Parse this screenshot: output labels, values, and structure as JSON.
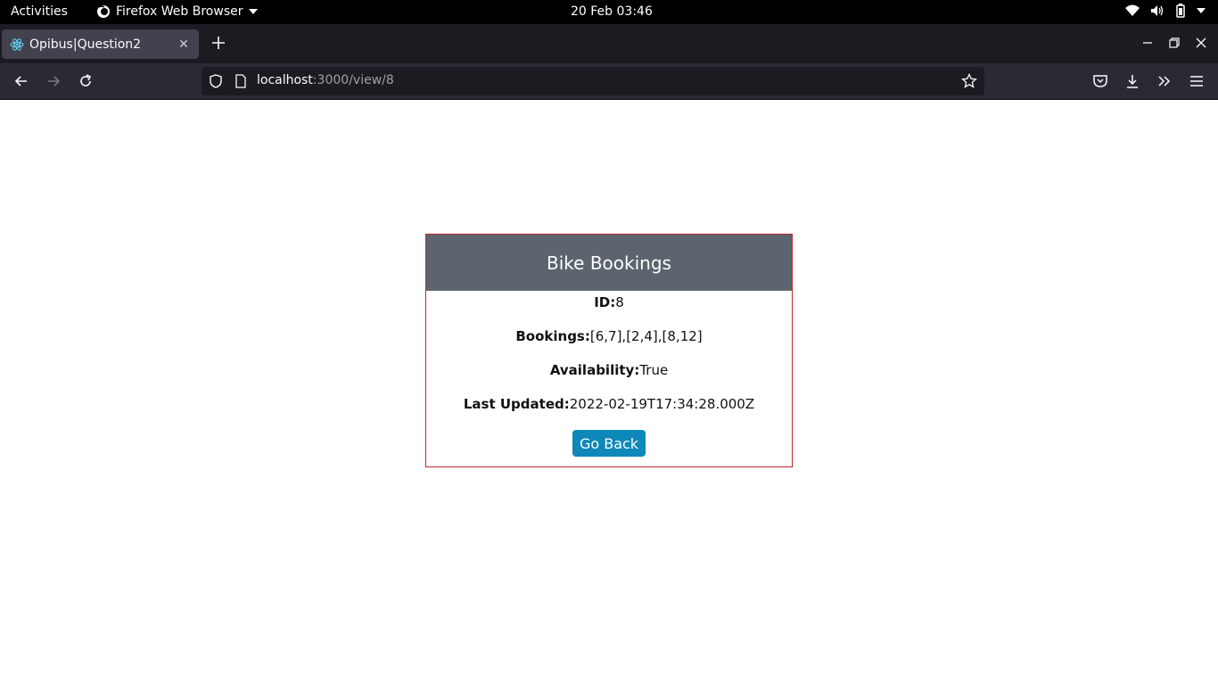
{
  "system_bar": {
    "activities": "Activities",
    "app_name": "Firefox Web Browser",
    "clock": "20 Feb  03:46"
  },
  "browser": {
    "tab_title": "Opibus|Question2",
    "url_host": "localhost",
    "url_path": ":3000/view/8"
  },
  "card": {
    "title": "Bike Bookings",
    "id_label": "ID:",
    "id_value": "8",
    "bookings_label": "Bookings:",
    "bookings_value": "[6,7],[2,4],[8,12]",
    "availability_label": "Availability:",
    "availability_value": "True",
    "updated_label": "Last Updated:",
    "updated_value": "2022-02-19T17:34:28.000Z",
    "button_label": "Go Back"
  },
  "colors": {
    "card_border": "#c1272d",
    "card_header": "#5c656d",
    "button": "#0d88b9"
  }
}
